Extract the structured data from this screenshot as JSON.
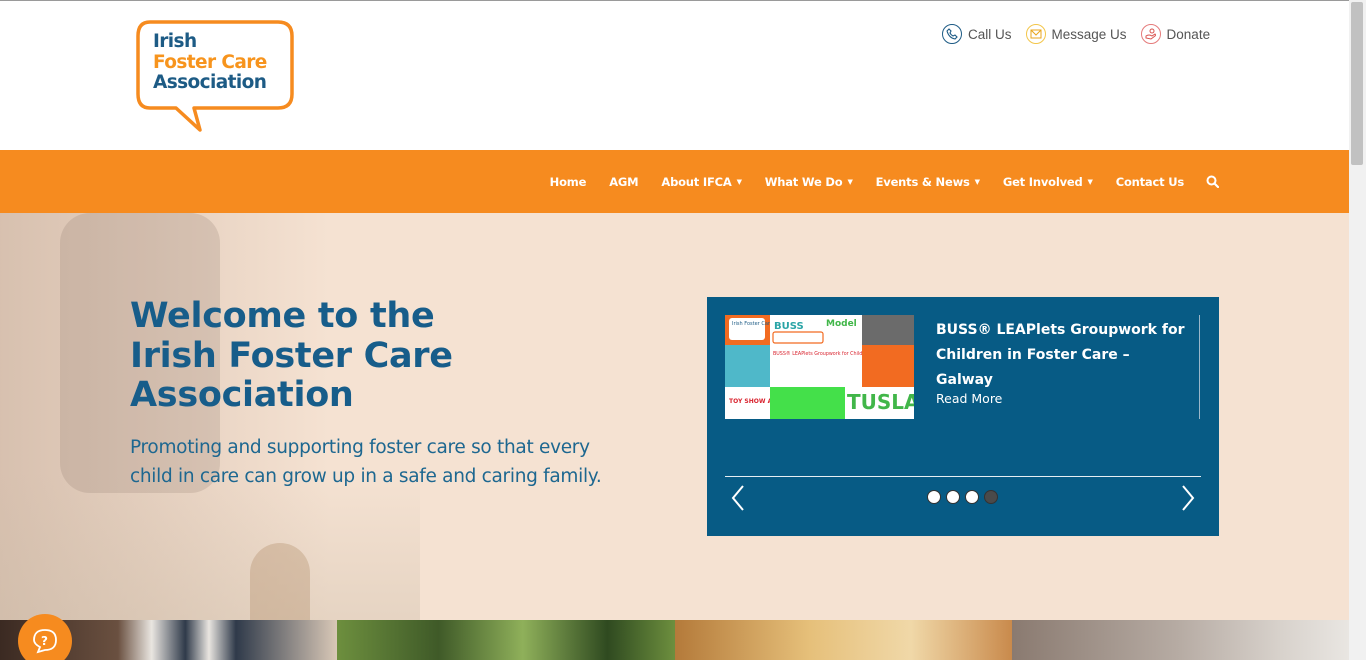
{
  "brand": {
    "logo_lines": [
      "Irish",
      "Foster Care",
      "Association"
    ],
    "colors": {
      "orange": "#f68b1f",
      "blue": "#175d8a",
      "slider_bg": "#075b85",
      "hero_bg": "#f5e2d2"
    }
  },
  "top_links": [
    {
      "label": "Call Us",
      "icon": "phone-icon"
    },
    {
      "label": "Message Us",
      "icon": "envelope-icon"
    },
    {
      "label": "Donate",
      "icon": "donate-hand-icon"
    }
  ],
  "nav": {
    "items": [
      {
        "label": "Home"
      },
      {
        "label": "AGM"
      },
      {
        "label": "About IFCA",
        "dropdown": true
      },
      {
        "label": "What We Do",
        "dropdown": true
      },
      {
        "label": "Events & News",
        "dropdown": true
      },
      {
        "label": "Get Involved",
        "dropdown": true
      },
      {
        "label": "Contact Us"
      }
    ],
    "search_icon": "search-icon"
  },
  "hero": {
    "title_lines": [
      "Welcome to the",
      "Irish Foster Care",
      "Association"
    ],
    "subtitle": "Promoting and supporting foster care so that every child in care can grow up in a safe and caring family."
  },
  "slider": {
    "title": "BUSS® LEAPlets Groupwork for Children in Foster Care – Galway",
    "read_more": "Read More",
    "image_texts": {
      "ifca": "Irish Foster Care Association",
      "buss": "BUSS",
      "model": "Model",
      "caption": "BUSS® LEAPlets Groupwork for Children in Foster Care",
      "toy_show": "TOY SHOW APPEAL",
      "tusla": "TUSLA"
    },
    "dots_total": 4,
    "active_dot": 4
  },
  "help_icon": "question-bubble-icon"
}
